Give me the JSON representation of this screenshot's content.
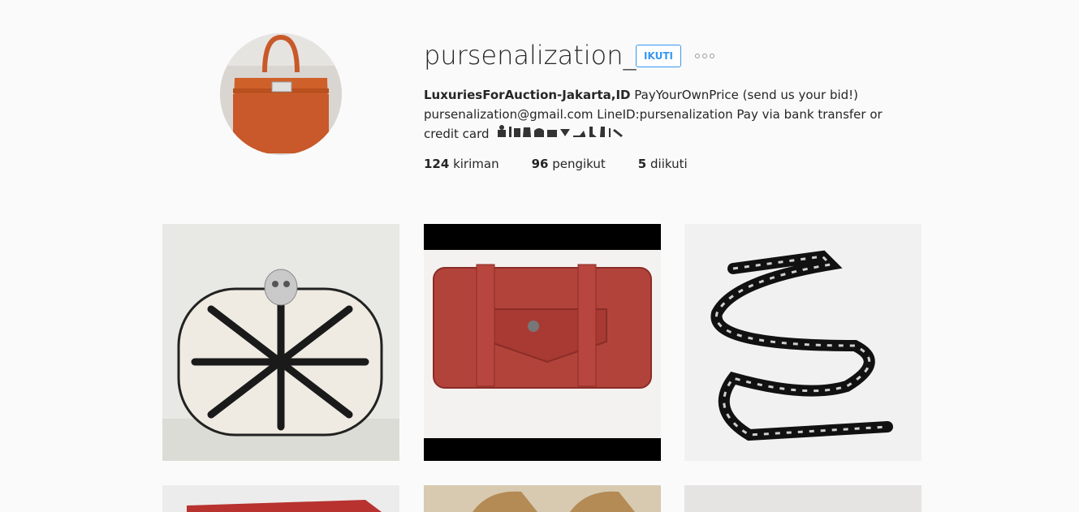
{
  "profile": {
    "username": "pursenalization_",
    "follow_label": "IKUTI",
    "bio_name": "LuxuriesForAuction-Jakarta,ID",
    "bio_text": " PayYourOwnPrice (send us your bid!) pursenalization@gmail.com LineID:pursenalization Pay via bank transfer or credit card",
    "bio_emoji": "👩‍💼👔👗👜👛💎👠👢👟💄",
    "stats": [
      {
        "count": "124",
        "label": " kiriman"
      },
      {
        "count": "96",
        "label": " pengikut"
      },
      {
        "count": "5",
        "label": " diikuti"
      }
    ]
  },
  "icons": {
    "more": "more-options-icon"
  },
  "colors": {
    "accent": "#3897f0",
    "text": "#262626",
    "background": "#fafafa"
  },
  "posts": [
    {
      "subject": "skull clutch"
    },
    {
      "subject": "red wallet"
    },
    {
      "subject": "chain belt"
    },
    {
      "subject": "red box"
    },
    {
      "subject": "beige shoes"
    },
    {
      "subject": "grey item"
    }
  ]
}
